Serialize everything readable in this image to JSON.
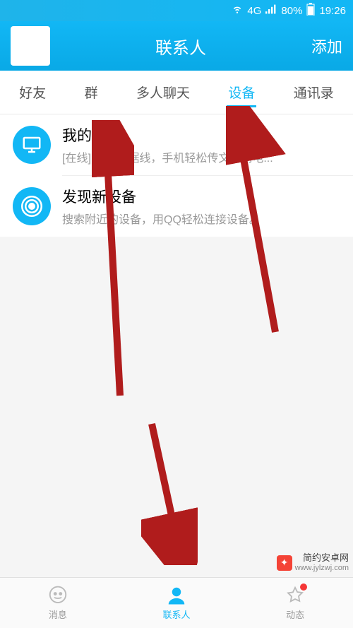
{
  "status_bar": {
    "network": "4G",
    "battery": "80%",
    "time": "19:26"
  },
  "header": {
    "title": "联系人",
    "add_label": "添加"
  },
  "tabs": [
    {
      "label": "好友"
    },
    {
      "label": "群"
    },
    {
      "label": "多人聊天"
    },
    {
      "label": "设备",
      "active": true
    },
    {
      "label": "通讯录"
    }
  ],
  "devices": [
    {
      "icon": "monitor-icon",
      "title": "我的电脑",
      "subtitle": "[在线] 无需数据线，手机轻松传文件到电..."
    },
    {
      "icon": "radar-icon",
      "title": "发现新设备",
      "subtitle": "搜索附近的设备，用QQ轻松连接设备。"
    }
  ],
  "bottom_nav": [
    {
      "label": "消息",
      "icon": "message-icon"
    },
    {
      "label": "联系人",
      "icon": "person-icon",
      "active": true
    },
    {
      "label": "动态",
      "icon": "star-icon",
      "dot": true
    }
  ],
  "watermark": {
    "brand": "简约安卓网",
    "url": "www.jylzwj.com"
  }
}
